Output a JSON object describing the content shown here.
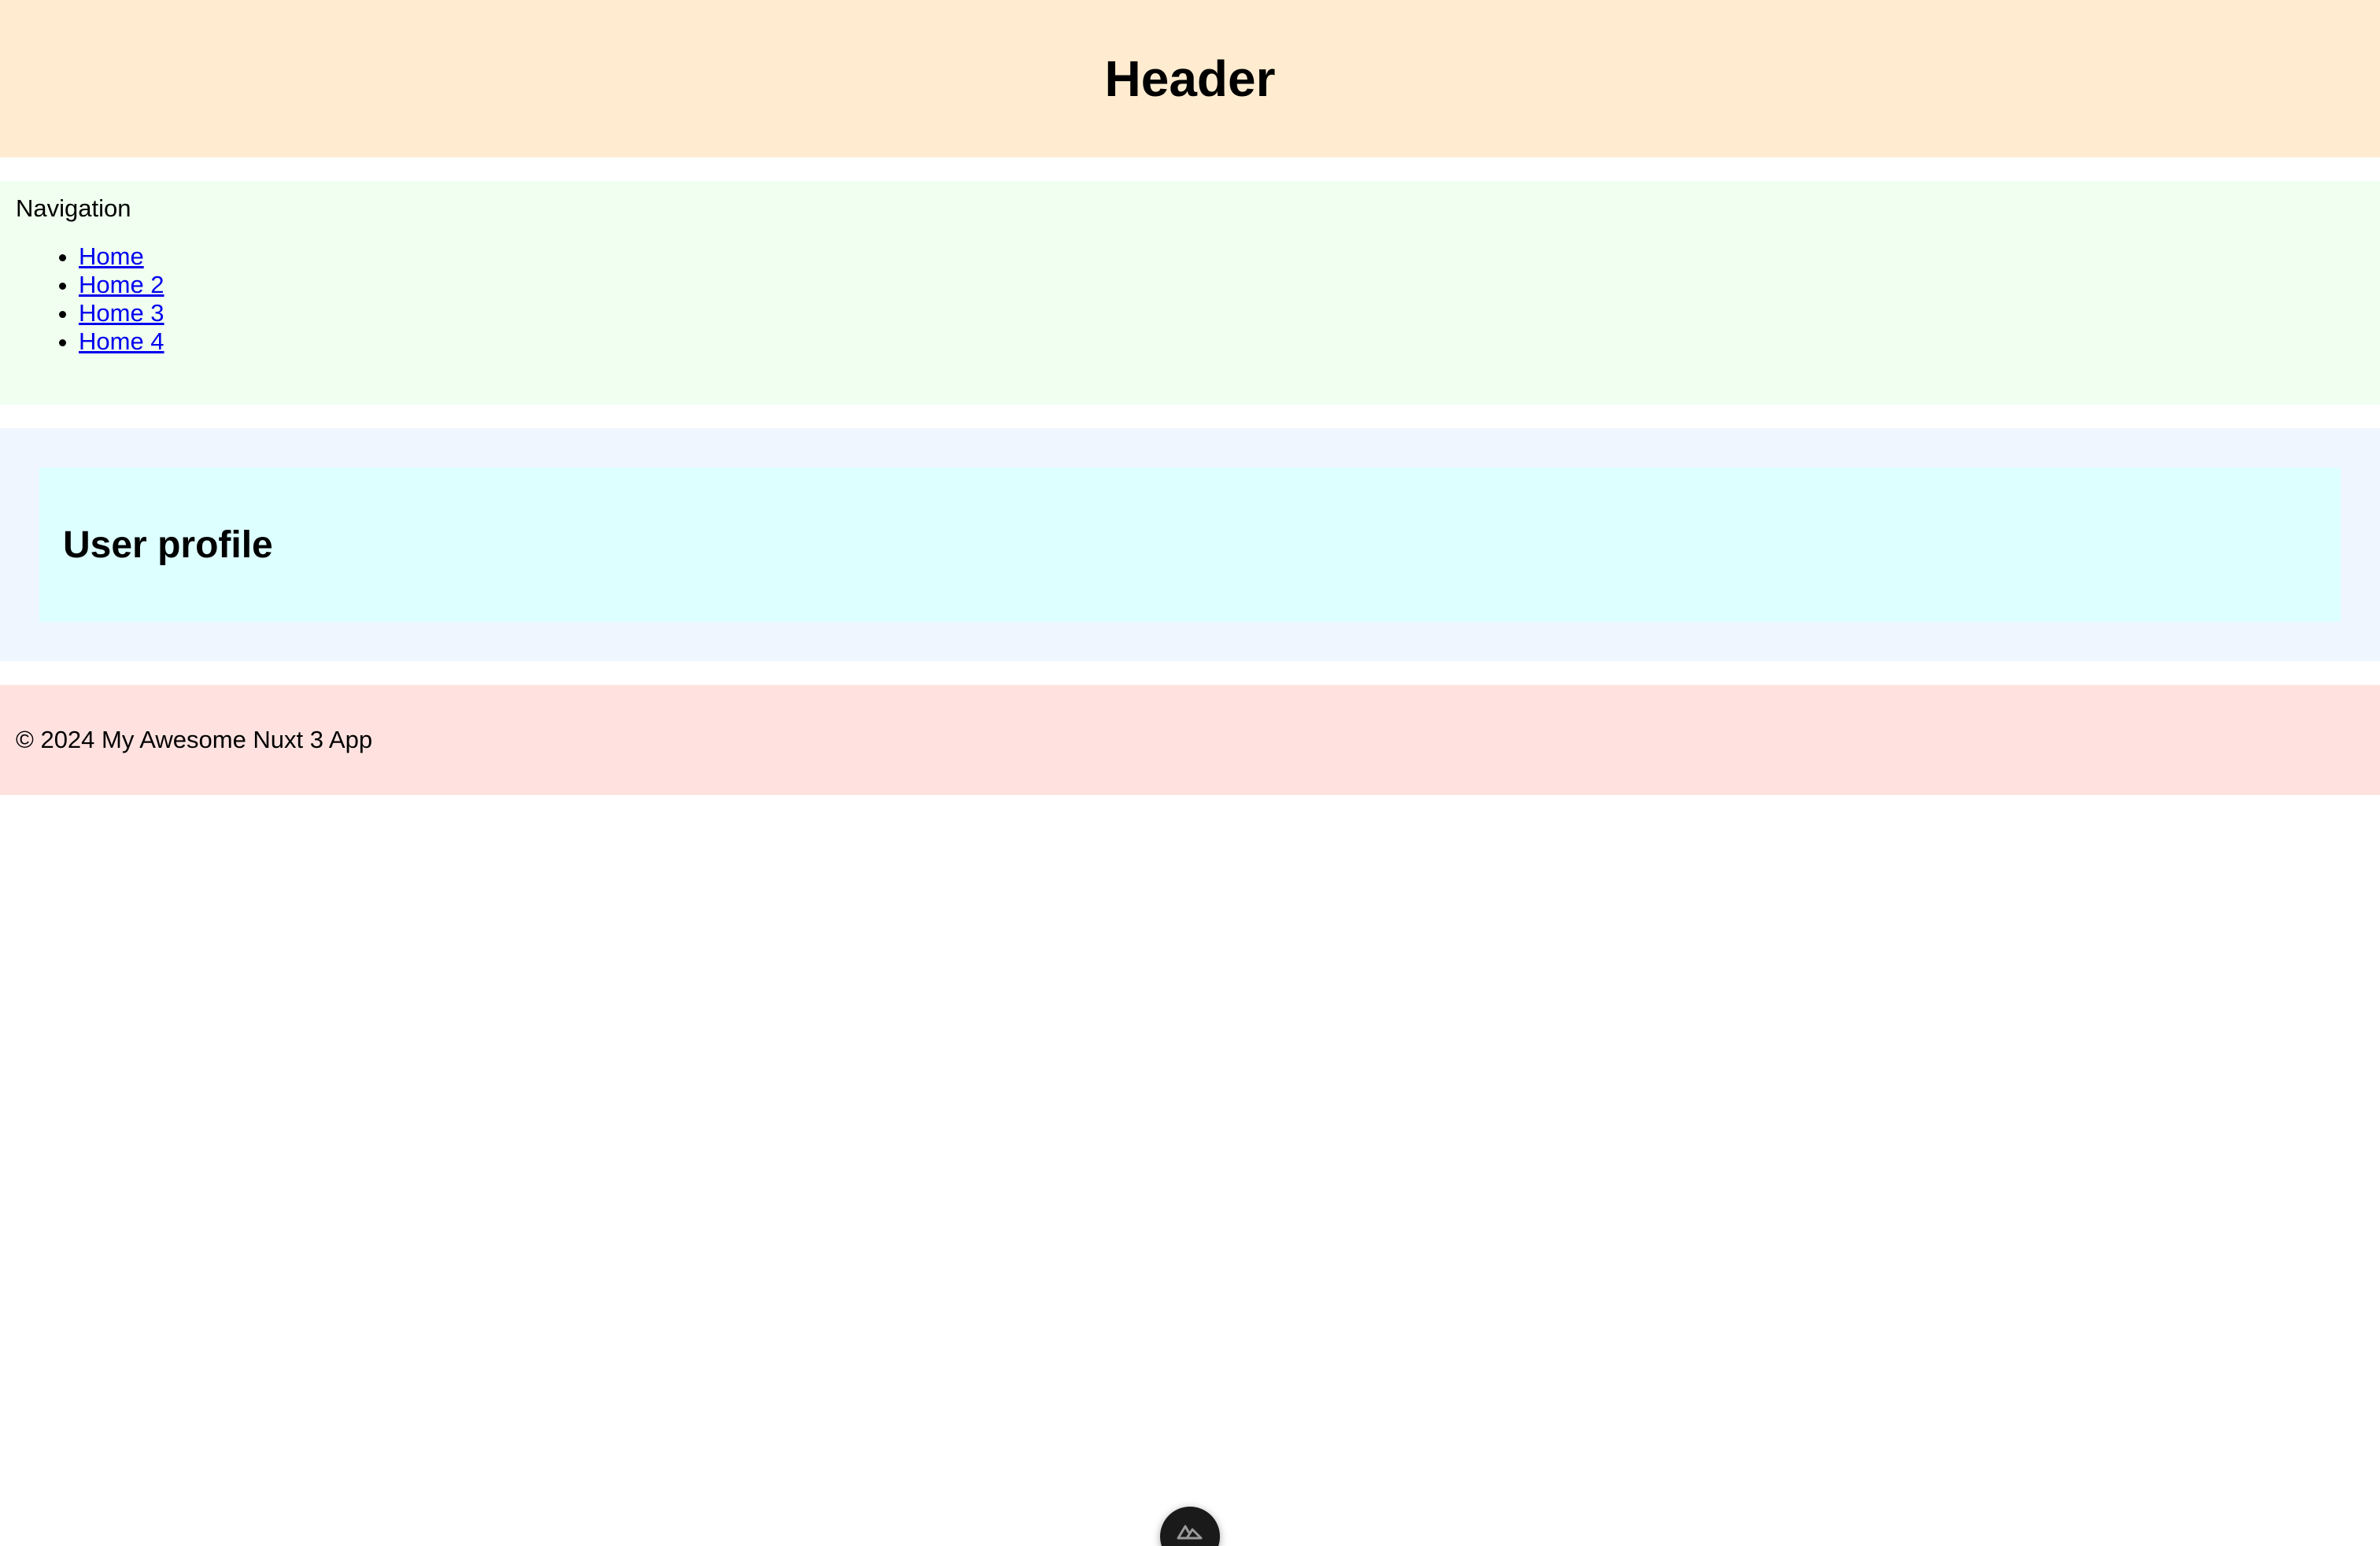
{
  "header": {
    "title": "Header"
  },
  "navigation": {
    "title": "Navigation",
    "links": [
      {
        "label": "Home"
      },
      {
        "label": "Home 2"
      },
      {
        "label": "Home 3"
      },
      {
        "label": "Home 4"
      }
    ]
  },
  "main": {
    "heading": "User profile"
  },
  "footer": {
    "text": "© 2024 My Awesome Nuxt 3 App"
  },
  "devtools": {
    "icon": "nuxt-logo-icon"
  },
  "colors": {
    "header_bg": "#ffecd0",
    "nav_bg": "#f0ffef",
    "main_bg": "#eff6ff",
    "card_bg": "#ddffff",
    "footer_bg": "#ffe2e0",
    "link": "#0000ee"
  }
}
